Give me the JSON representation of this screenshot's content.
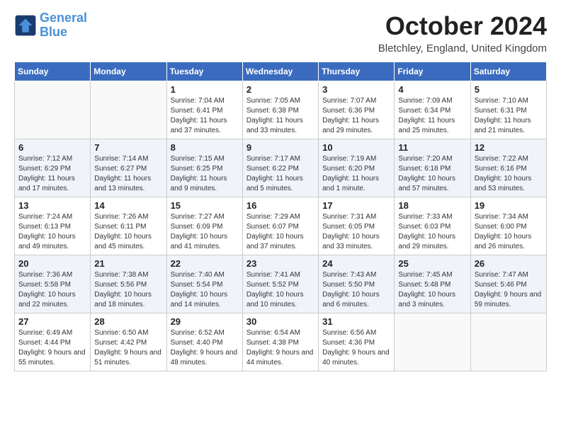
{
  "header": {
    "logo_line1": "General",
    "logo_line2": "Blue",
    "month": "October 2024",
    "location": "Bletchley, England, United Kingdom"
  },
  "days_of_week": [
    "Sunday",
    "Monday",
    "Tuesday",
    "Wednesday",
    "Thursday",
    "Friday",
    "Saturday"
  ],
  "weeks": [
    [
      {
        "day": "",
        "info": ""
      },
      {
        "day": "",
        "info": ""
      },
      {
        "day": "1",
        "info": "Sunrise: 7:04 AM\nSunset: 6:41 PM\nDaylight: 11 hours and 37 minutes."
      },
      {
        "day": "2",
        "info": "Sunrise: 7:05 AM\nSunset: 6:38 PM\nDaylight: 11 hours and 33 minutes."
      },
      {
        "day": "3",
        "info": "Sunrise: 7:07 AM\nSunset: 6:36 PM\nDaylight: 11 hours and 29 minutes."
      },
      {
        "day": "4",
        "info": "Sunrise: 7:09 AM\nSunset: 6:34 PM\nDaylight: 11 hours and 25 minutes."
      },
      {
        "day": "5",
        "info": "Sunrise: 7:10 AM\nSunset: 6:31 PM\nDaylight: 11 hours and 21 minutes."
      }
    ],
    [
      {
        "day": "6",
        "info": "Sunrise: 7:12 AM\nSunset: 6:29 PM\nDaylight: 11 hours and 17 minutes."
      },
      {
        "day": "7",
        "info": "Sunrise: 7:14 AM\nSunset: 6:27 PM\nDaylight: 11 hours and 13 minutes."
      },
      {
        "day": "8",
        "info": "Sunrise: 7:15 AM\nSunset: 6:25 PM\nDaylight: 11 hours and 9 minutes."
      },
      {
        "day": "9",
        "info": "Sunrise: 7:17 AM\nSunset: 6:22 PM\nDaylight: 11 hours and 5 minutes."
      },
      {
        "day": "10",
        "info": "Sunrise: 7:19 AM\nSunset: 6:20 PM\nDaylight: 11 hours and 1 minute."
      },
      {
        "day": "11",
        "info": "Sunrise: 7:20 AM\nSunset: 6:18 PM\nDaylight: 10 hours and 57 minutes."
      },
      {
        "day": "12",
        "info": "Sunrise: 7:22 AM\nSunset: 6:16 PM\nDaylight: 10 hours and 53 minutes."
      }
    ],
    [
      {
        "day": "13",
        "info": "Sunrise: 7:24 AM\nSunset: 6:13 PM\nDaylight: 10 hours and 49 minutes."
      },
      {
        "day": "14",
        "info": "Sunrise: 7:26 AM\nSunset: 6:11 PM\nDaylight: 10 hours and 45 minutes."
      },
      {
        "day": "15",
        "info": "Sunrise: 7:27 AM\nSunset: 6:09 PM\nDaylight: 10 hours and 41 minutes."
      },
      {
        "day": "16",
        "info": "Sunrise: 7:29 AM\nSunset: 6:07 PM\nDaylight: 10 hours and 37 minutes."
      },
      {
        "day": "17",
        "info": "Sunrise: 7:31 AM\nSunset: 6:05 PM\nDaylight: 10 hours and 33 minutes."
      },
      {
        "day": "18",
        "info": "Sunrise: 7:33 AM\nSunset: 6:03 PM\nDaylight: 10 hours and 29 minutes."
      },
      {
        "day": "19",
        "info": "Sunrise: 7:34 AM\nSunset: 6:00 PM\nDaylight: 10 hours and 26 minutes."
      }
    ],
    [
      {
        "day": "20",
        "info": "Sunrise: 7:36 AM\nSunset: 5:58 PM\nDaylight: 10 hours and 22 minutes."
      },
      {
        "day": "21",
        "info": "Sunrise: 7:38 AM\nSunset: 5:56 PM\nDaylight: 10 hours and 18 minutes."
      },
      {
        "day": "22",
        "info": "Sunrise: 7:40 AM\nSunset: 5:54 PM\nDaylight: 10 hours and 14 minutes."
      },
      {
        "day": "23",
        "info": "Sunrise: 7:41 AM\nSunset: 5:52 PM\nDaylight: 10 hours and 10 minutes."
      },
      {
        "day": "24",
        "info": "Sunrise: 7:43 AM\nSunset: 5:50 PM\nDaylight: 10 hours and 6 minutes."
      },
      {
        "day": "25",
        "info": "Sunrise: 7:45 AM\nSunset: 5:48 PM\nDaylight: 10 hours and 3 minutes."
      },
      {
        "day": "26",
        "info": "Sunrise: 7:47 AM\nSunset: 5:46 PM\nDaylight: 9 hours and 59 minutes."
      }
    ],
    [
      {
        "day": "27",
        "info": "Sunrise: 6:49 AM\nSunset: 4:44 PM\nDaylight: 9 hours and 55 minutes."
      },
      {
        "day": "28",
        "info": "Sunrise: 6:50 AM\nSunset: 4:42 PM\nDaylight: 9 hours and 51 minutes."
      },
      {
        "day": "29",
        "info": "Sunrise: 6:52 AM\nSunset: 4:40 PM\nDaylight: 9 hours and 48 minutes."
      },
      {
        "day": "30",
        "info": "Sunrise: 6:54 AM\nSunset: 4:38 PM\nDaylight: 9 hours and 44 minutes."
      },
      {
        "day": "31",
        "info": "Sunrise: 6:56 AM\nSunset: 4:36 PM\nDaylight: 9 hours and 40 minutes."
      },
      {
        "day": "",
        "info": ""
      },
      {
        "day": "",
        "info": ""
      }
    ]
  ]
}
